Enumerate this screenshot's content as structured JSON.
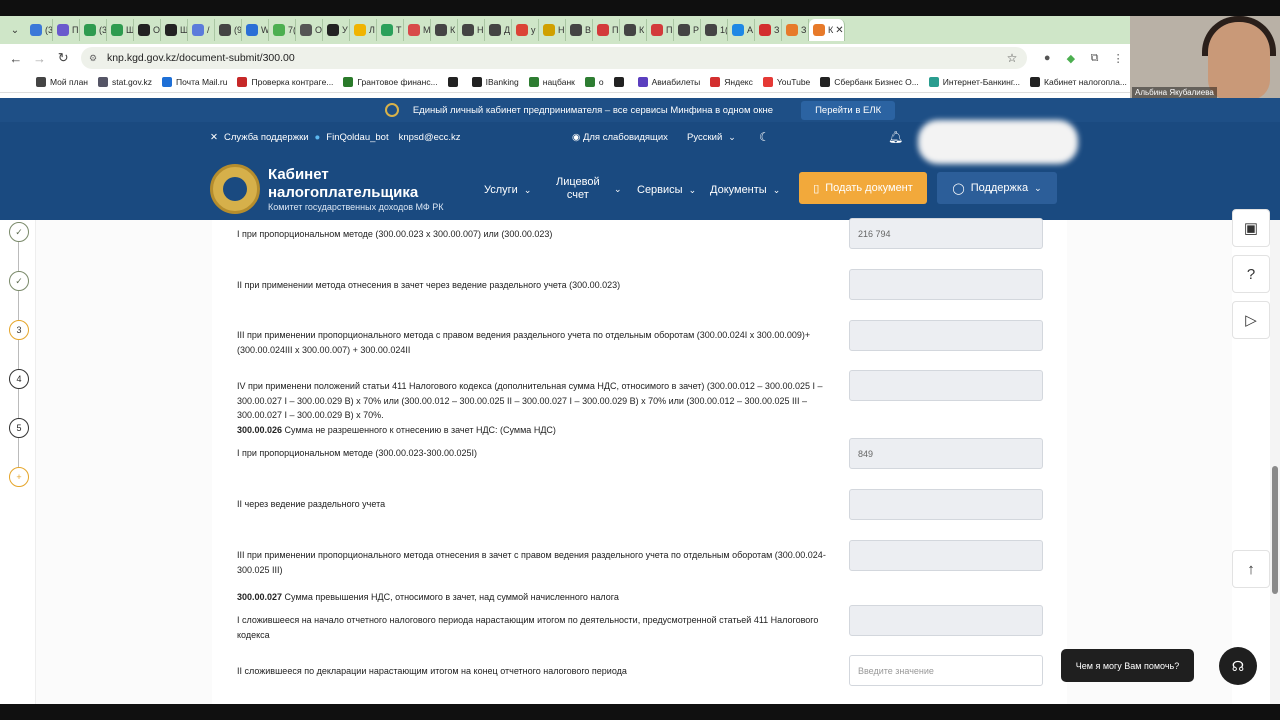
{
  "browser": {
    "url": "knp.kgd.gov.kz/document-submit/300.00",
    "tabs": [
      "(3",
      "П",
      "(3",
      "Ш",
      "О",
      "Ш",
      "/",
      "(9",
      "W",
      "7(",
      "О",
      "У",
      "Л",
      "Т",
      "М",
      "К",
      "Н",
      "Д",
      "у",
      "Н",
      "В",
      "П",
      "К",
      "П",
      "Р",
      "1(",
      "А",
      "З",
      "З",
      "К"
    ],
    "tab_colors": [
      "#3b78d8",
      "#6a5acd",
      "#2e9b4f",
      "#2e9b4f",
      "#222",
      "#222",
      "#5b7bdb",
      "#444",
      "#2a6fd6",
      "#4caf50",
      "#555",
      "#222",
      "#f0b400",
      "#2aa05a",
      "#d84a4a",
      "#444",
      "#444",
      "#444",
      "#db4437",
      "#d0a000",
      "#444",
      "#d33a3a",
      "#444",
      "#d33a3a",
      "#444",
      "#444",
      "#1e88e5",
      "#d32f2f",
      "#e77a2a",
      "#e77a2a",
      "#444"
    ],
    "bookmarks": [
      {
        "label": "Мой план",
        "icon": "calendar-icon",
        "color": "#444"
      },
      {
        "label": "stat.gov.kz",
        "icon": "stat-icon",
        "color": "#556"
      },
      {
        "label": "Почта Mail.ru",
        "icon": "mail-icon",
        "color": "#1e6fd6"
      },
      {
        "label": "Проверка контрагe...",
        "icon": "check-icon",
        "color": "#c62828"
      },
      {
        "label": "Грантовое финанс...",
        "icon": "grant-icon",
        "color": "#2a7a2a"
      },
      {
        "label": "",
        "icon": "globe-icon",
        "color": "#222"
      },
      {
        "label": "IBanking",
        "icon": "bank-icon",
        "color": "#222"
      },
      {
        "label": "нацбанк",
        "icon": "natbank-icon",
        "color": "#2e7d32"
      },
      {
        "label": "о",
        "icon": "dollar-icon",
        "color": "#2e7d32"
      },
      {
        "label": "",
        "icon": "globe-icon",
        "color": "#222"
      },
      {
        "label": "Авиабилеты",
        "icon": "plane-icon",
        "color": "#5b3fbf"
      },
      {
        "label": "Яндекс",
        "icon": "yandex-icon",
        "color": "#d32f2f"
      },
      {
        "label": "YouTube",
        "icon": "youtube-icon",
        "color": "#e53935"
      },
      {
        "label": "Сбербанк Бизнес О...",
        "icon": "sber-icon",
        "color": "#222"
      },
      {
        "label": "Интернет-Банкинг...",
        "icon": "ib-icon",
        "color": "#2a9d8f"
      },
      {
        "label": "Кабинет налогопла...",
        "icon": "globe-icon",
        "color": "#222"
      }
    ]
  },
  "video": {
    "name": "Альбина Якубалиева"
  },
  "gov_banner": {
    "text": "Единый личный кабинет предпринимателя – все сервисы Минфина в одном окне",
    "button": "Перейти в ЕЛК"
  },
  "topline": {
    "support": "Служба поддержки",
    "bot": "FinQoldau_bot",
    "email": "knpsd@ecc.kz",
    "accessibility": "Для слабовидящих",
    "language": "Русский"
  },
  "brand": {
    "title_line1": "Кабинет",
    "title_line2": "налогоплательщика",
    "subtitle": "Комитет государственных доходов МФ РК"
  },
  "menu": {
    "services": "Услуги",
    "account": "Лицевой",
    "account2": "счет",
    "service2": "Сервисы",
    "documents": "Документы",
    "submit": "Подать документ",
    "support": "Поддержка"
  },
  "stepper": {
    "steps": [
      "",
      "",
      "3",
      "4",
      "5",
      "+"
    ]
  },
  "rows": [
    {
      "text_bold": "",
      "text": "I  при пропорциональном методе (300.00.023 x 300.00.007) или (300.00.023)",
      "value": "216 794"
    },
    {
      "text_bold": "",
      "text": "II  при применении метода отнесения в зачет через ведение раздельного учета (300.00.023)",
      "value": ""
    },
    {
      "text_bold": "",
      "text": "III  при применении пропорционального метода с правом ведения раздельного учета по отдельным оборотам (300.00.024I x 300.00.009)+(300.00.024III x 300.00.007) + 300.00.024II",
      "value": ""
    },
    {
      "text_bold": "",
      "text": "IV  при применени положений статьи 411 Налогового кодекса (дополнительная сумма НДС, относимого в зачет) (300.00.012 – 300.00.025 I – 300.00.027 I – 300.00.029 В) x 70% или (300.00.012 – 300.00.025 II – 300.00.027 I – 300.00.029 В) x 70% или (300.00.012 – 300.00.025 III – 300.00.027 I – 300.00.029 В) x 70%.",
      "value": ""
    },
    {
      "text_bold": "300.00.026",
      "text": "  Сумма не разрешенного к отнесению в зачет НДС: (Сумма НДС)",
      "value": null
    },
    {
      "text_bold": "",
      "text": "I  при пропорциональном методе (300.00.023-300.00.025I)",
      "value": "849"
    },
    {
      "text_bold": "",
      "text": "II  через ведение раздельного учета",
      "value": ""
    },
    {
      "text_bold": "",
      "text": "III  при применении пропорционального метода отнесения в зачет с правом ведения раздельного учета по отдельным оборотам (300.00.024-300.025 III)",
      "value": ""
    },
    {
      "text_bold": "300.00.027",
      "text": "  Сумма превышения НДС, относимого в зачет, над суммой начисленного налога",
      "value": null
    },
    {
      "text_bold": "",
      "text": "I  сложившееся на начало отчетного налогового периода нарастающим итогом по деятельности, предусмотренной статьей 411 Налогового кодекса",
      "value": ""
    },
    {
      "text_bold": "",
      "text": "II  сложившееся по декларации нарастающим итогом на конец отчетного налогового периода",
      "value": ""
    }
  ],
  "placeholder": "Введите значение",
  "chat": {
    "prompt": "Чем я могу Вам помочь?"
  },
  "colors": {
    "header": "#1a4a80",
    "banner": "#1e4f86",
    "accent": "#f2a93b"
  }
}
